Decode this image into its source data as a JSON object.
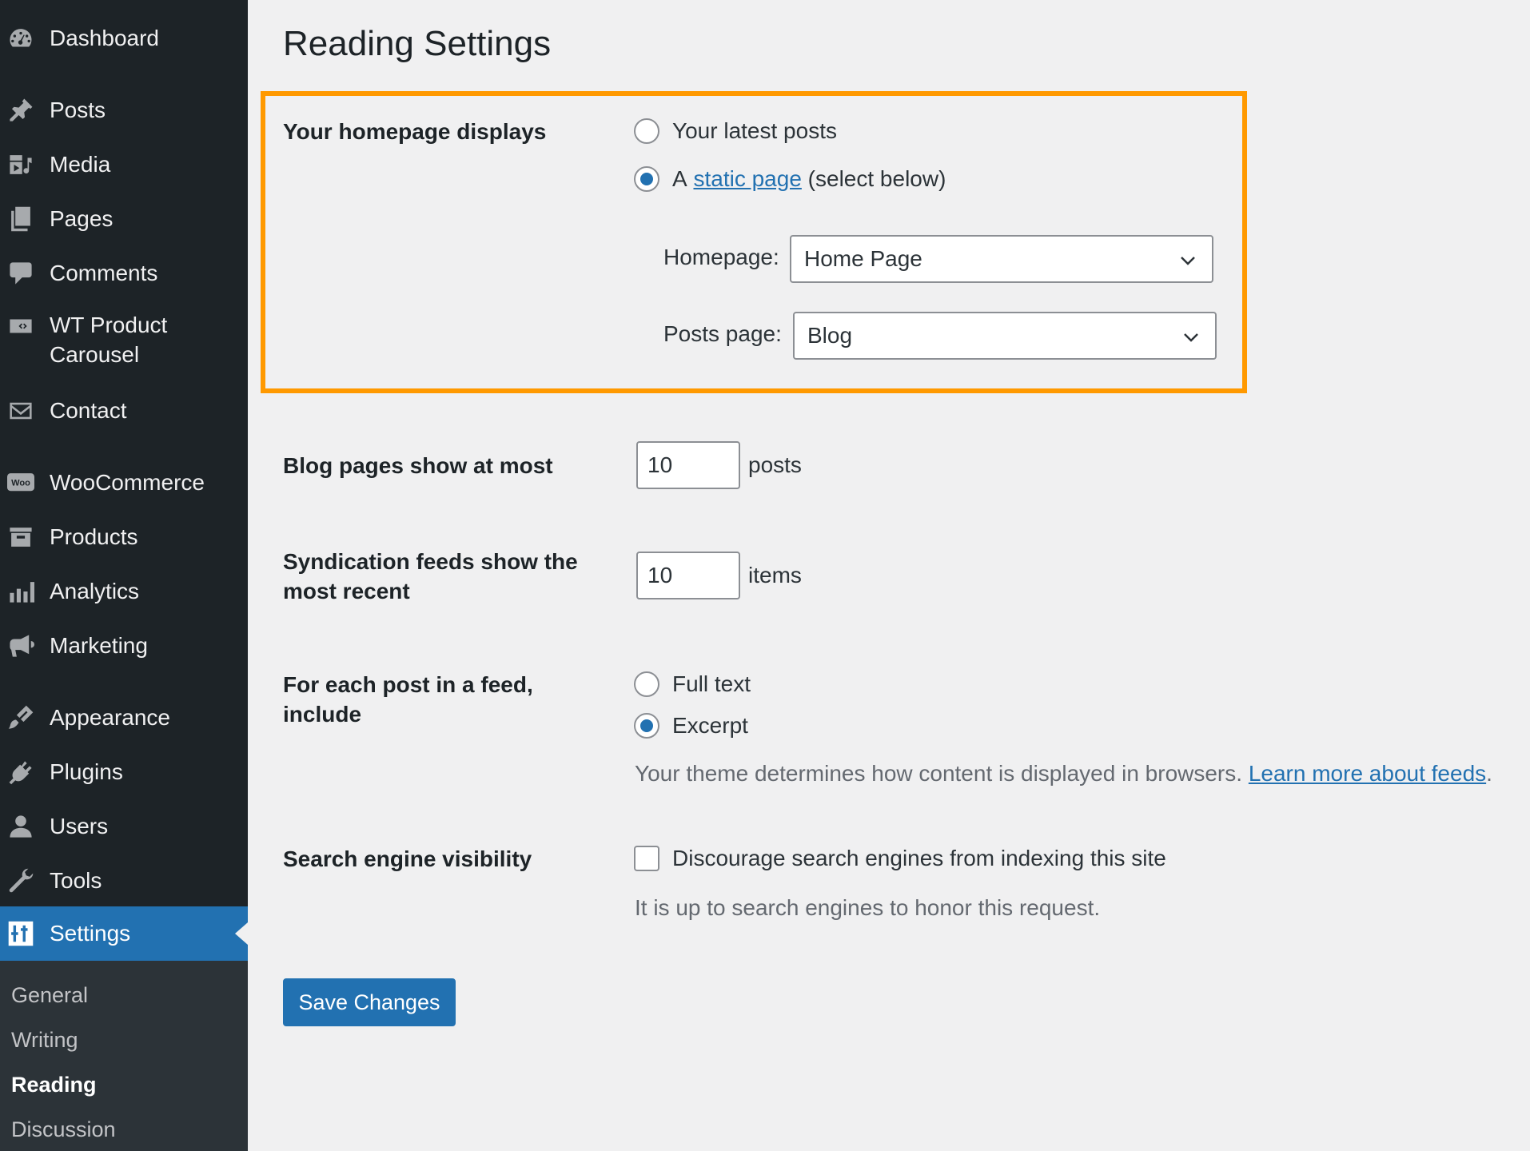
{
  "sidebar": {
    "items": [
      {
        "label": "Dashboard",
        "icon": "dashboard-icon"
      },
      {
        "label": "Posts",
        "icon": "pin-icon"
      },
      {
        "label": "Media",
        "icon": "media-icon"
      },
      {
        "label": "Pages",
        "icon": "pages-icon"
      },
      {
        "label": "Comments",
        "icon": "comment-icon"
      },
      {
        "label": "WT Product Carousel",
        "icon": "carousel-icon"
      },
      {
        "label": "Contact",
        "icon": "mail-icon"
      },
      {
        "label": "WooCommerce",
        "icon": "woo-icon"
      },
      {
        "label": "Products",
        "icon": "archive-icon"
      },
      {
        "label": "Analytics",
        "icon": "bar-chart-icon"
      },
      {
        "label": "Marketing",
        "icon": "megaphone-icon"
      },
      {
        "label": "Appearance",
        "icon": "brush-icon"
      },
      {
        "label": "Plugins",
        "icon": "plug-icon"
      },
      {
        "label": "Users",
        "icon": "user-icon"
      },
      {
        "label": "Tools",
        "icon": "wrench-icon"
      },
      {
        "label": "Settings",
        "icon": "settings-icon"
      }
    ],
    "woo_icon_text": "Woo",
    "submenu": [
      "General",
      "Writing",
      "Reading",
      "Discussion"
    ]
  },
  "main": {
    "title": "Reading Settings",
    "homepage_displays": {
      "label": "Your homepage displays",
      "option_latest": "Your latest posts",
      "option_static_prefix": "A",
      "option_static_link": "static page",
      "option_static_suffix": "(select below)",
      "selected": "static",
      "homepage_label": "Homepage:",
      "homepage_value": "Home Page",
      "posts_page_label": "Posts page:",
      "posts_page_value": "Blog"
    },
    "blog_pages": {
      "label": "Blog pages show at most",
      "value": "10",
      "unit": "posts"
    },
    "syndication": {
      "label": "Syndication feeds show the most recent",
      "value": "10",
      "unit": "items"
    },
    "feed_include": {
      "label": "For each post in a feed, include",
      "option_full": "Full text",
      "option_excerpt": "Excerpt",
      "selected": "excerpt",
      "description": "Your theme determines how content is displayed in browsers.",
      "link": "Learn more about feeds",
      "link_suffix": "."
    },
    "search_visibility": {
      "label": "Search engine visibility",
      "checkbox_label": "Discourage search engines from indexing this site",
      "checked": false,
      "description": "It is up to search engines to honor this request."
    },
    "save_label": "Save Changes"
  },
  "colors": {
    "accent": "#2271b1",
    "highlight": "#ff9900",
    "sidebar": "#1d2327"
  }
}
